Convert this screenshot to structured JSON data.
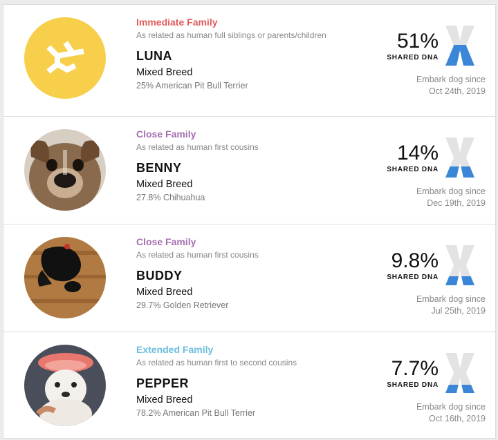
{
  "colors": {
    "immediate": "#e05a5a",
    "close": "#a56eb2",
    "extended": "#6bbde0",
    "dna_blue": "#3b86d6",
    "dna_gray": "#e3e3e3",
    "luna_avatar": "#f7cf4a"
  },
  "dogs": [
    {
      "family": "Immediate Family",
      "family_color": "#e05a5a",
      "relation": "As related as human full siblings or parents/children",
      "name": "LUNA",
      "breed": "Mixed Breed",
      "ancestry": "25% American Pit Bull Terrier",
      "percent": "51%",
      "shared_label": "SHARED DNA",
      "shared_fraction": 0.51,
      "since_label": "Embark dog since",
      "since_date": "Oct 24th, 2019",
      "avatar_icon": "embark-logo-icon"
    },
    {
      "family": "Close Family",
      "family_color": "#a56eb2",
      "relation": "As related as human first cousins",
      "name": "BENNY",
      "breed": "Mixed Breed",
      "ancestry": "27.8% Chihuahua",
      "percent": "14%",
      "shared_label": "SHARED DNA",
      "shared_fraction": 0.14,
      "since_label": "Embark dog since",
      "since_date": "Dec 19th, 2019",
      "avatar_icon": "dog-photo"
    },
    {
      "family": "Close Family",
      "family_color": "#a56eb2",
      "relation": "As related as human first cousins",
      "name": "BUDDY",
      "breed": "Mixed Breed",
      "ancestry": "29.7% Golden Retriever",
      "percent": "9.8%",
      "shared_label": "SHARED DNA",
      "shared_fraction": 0.098,
      "since_label": "Embark dog since",
      "since_date": "Jul 25th, 2019",
      "avatar_icon": "dog-photo"
    },
    {
      "family": "Extended Family",
      "family_color": "#6bbde0",
      "relation": "As related as human first to second cousins",
      "name": "PEPPER",
      "breed": "Mixed Breed",
      "ancestry": "78.2% American Pit Bull Terrier",
      "percent": "7.7%",
      "shared_label": "SHARED DNA",
      "shared_fraction": 0.077,
      "since_label": "Embark dog since",
      "since_date": "Oct 16th, 2019",
      "avatar_icon": "dog-photo"
    }
  ]
}
